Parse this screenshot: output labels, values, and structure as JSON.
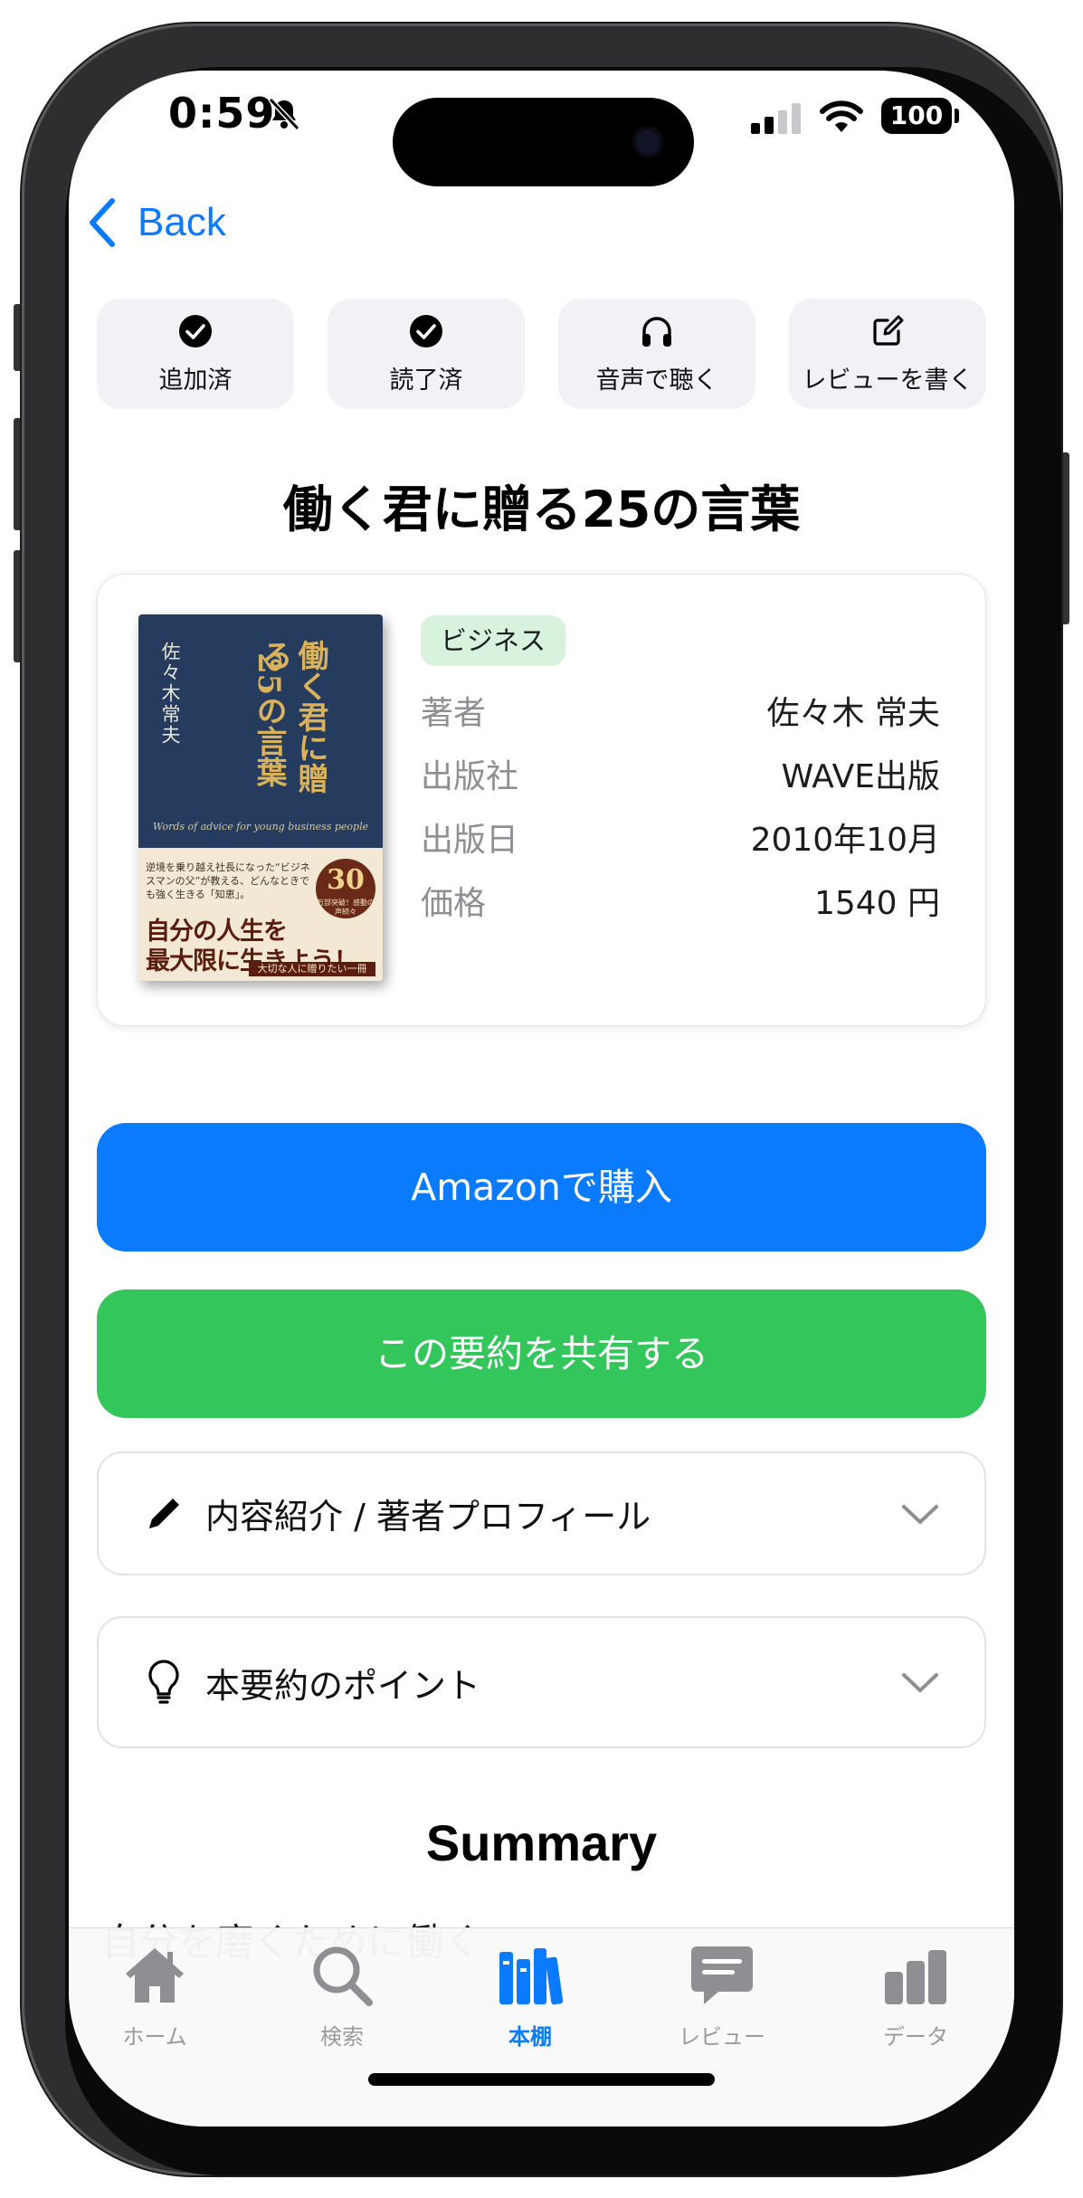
{
  "status_bar": {
    "time": "0:59",
    "battery": "100",
    "icons": [
      "bell-slash-icon",
      "cellular-signal-icon",
      "wifi-icon",
      "battery-icon"
    ]
  },
  "nav": {
    "back_label": "Back",
    "back_icon": "chevron-left-icon"
  },
  "actions": [
    {
      "label": "追加済",
      "icon": "checkmark-circle-icon"
    },
    {
      "label": "読了済",
      "icon": "checkmark-circle-icon"
    },
    {
      "label": "音声で聴く",
      "icon": "headphones-icon"
    },
    {
      "label": "レビューを書く",
      "icon": "square-pencil-icon"
    }
  ],
  "book": {
    "title": "働く君に贈る25の言葉",
    "genre": "ビジネス",
    "details": [
      {
        "key": "著者",
        "value": "佐々木 常夫"
      },
      {
        "key": "出版社",
        "value": "WAVE出版"
      },
      {
        "key": "出版日",
        "value": "2010年10月"
      },
      {
        "key": "価格",
        "value": "1540 円"
      }
    ],
    "cover": {
      "author": "佐々木常夫",
      "title_line1": "働く君に贈る",
      "title_line2": "25の言葉",
      "subtitle_en": "Words of advice for young business people",
      "blurb": "逆境を乗り越え社長になった“ビジネスマンの父”が教える、どんなときでも強く生きる「知恵」。",
      "badge_number": "30",
      "badge_text": "万部突破！感動の声続々",
      "catch_line1": "自分の人生を",
      "catch_line2": "最大限に生きよう！",
      "strip": "大切な人に贈りたい一冊"
    }
  },
  "buttons": {
    "amazon": "Amazonで購入",
    "share": "この要約を共有する"
  },
  "sections": [
    {
      "label": "内容紹介 / 著者プロフィール",
      "icon": "pencil-icon"
    },
    {
      "label": "本要約のポイント",
      "icon": "lightbulb-icon"
    }
  ],
  "summary": {
    "heading": "Summary",
    "first_line": "自分を磨くために働く"
  },
  "tabbar": {
    "items": [
      {
        "label": "ホーム",
        "icon": "house-icon",
        "active": false
      },
      {
        "label": "検索",
        "icon": "magnifyingglass-icon",
        "active": false
      },
      {
        "label": "本棚",
        "icon": "books-icon",
        "active": true
      },
      {
        "label": "レビュー",
        "icon": "message-bubble-icon",
        "active": false
      },
      {
        "label": "データ",
        "icon": "chart-bar-icon",
        "active": false
      }
    ]
  },
  "colors": {
    "accent_blue": "#0a7bff",
    "share_green": "#33c65b",
    "genre_badge": "#d7f2dd",
    "tile_bg": "#f1f1f6",
    "inactive_tab": "#9a9a9f"
  }
}
